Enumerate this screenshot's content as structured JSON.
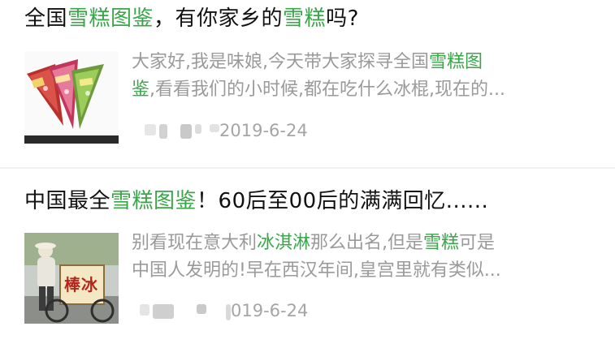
{
  "colors": {
    "highlight": "#3aa64a",
    "title": "#111111",
    "summary": "#9a9a9a",
    "date": "#a5a5a5"
  },
  "results": [
    {
      "title_parts": [
        "全国",
        "雪糕图鉴",
        "，有你家乡的",
        "雪糕",
        "吗?"
      ],
      "thumbnail_icon": "ice-cream-cones-photo",
      "summary_line1_parts": [
        "大家好,我是味娘,今天带大家探寻全国",
        "雪糕图"
      ],
      "summary_line2_parts": [
        "鉴",
        ",看看我们的小时候,都在吃什么冰棍,现在的..."
      ],
      "date": "2019-6-24"
    },
    {
      "title_parts": [
        "中国最全",
        "雪糕图鉴",
        "！60后至00后的满满回忆......"
      ],
      "thumbnail_icon": "ice-pop-vendor-photo",
      "thumbnail_sign": "棒冰",
      "summary_line1_parts": [
        "别看现在意大利",
        "冰淇淋",
        "那么出名,但是",
        "雪糕",
        "可是"
      ],
      "summary_line2_parts": [
        "中国人发明的!早在西汉年间,皇宫里就有类似..."
      ],
      "date": "019-6-24"
    }
  ]
}
